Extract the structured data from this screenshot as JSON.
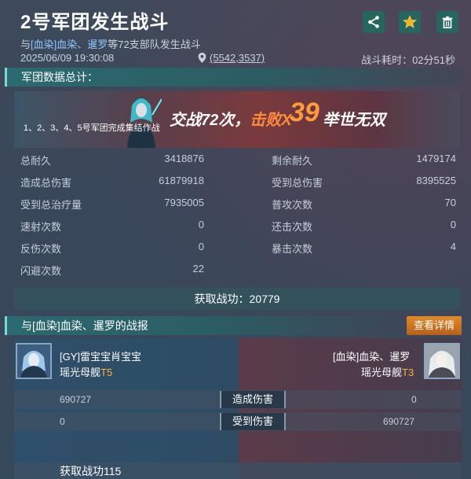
{
  "header": {
    "title": "2号军团发生战斗",
    "subtitle_prefix": "与",
    "subtitle_enemy": "[血染]血染、暹罗",
    "subtitle_suffix": "等72支部队发生战斗",
    "datetime": "2025/06/09 19:30:08",
    "coordinates": "(5542,3537)",
    "duration_label": "战斗耗时：",
    "duration_value": "02分51秒",
    "icons": [
      "share-icon",
      "star-icon",
      "trash-icon"
    ],
    "accent_color": "#27665f"
  },
  "summary": {
    "section_title": "军团数据总计：",
    "banner": {
      "battles": "交战72次，",
      "defeat_prefix": "击败X",
      "defeat_count": "39",
      "epithet": "举世无双",
      "note": "1、2、3、4、5号军团完成集结作战"
    },
    "stats": [
      {
        "label": "总耐久",
        "value": "3418876"
      },
      {
        "label": "剩余耐久",
        "value": "1479174"
      },
      {
        "label": "造成总伤害",
        "value": "61879918"
      },
      {
        "label": "受到总伤害",
        "value": "8395525"
      },
      {
        "label": "受到总治疗量",
        "value": "7935005"
      },
      {
        "label": "普攻次数",
        "value": "70"
      },
      {
        "label": "速射次数",
        "value": "0"
      },
      {
        "label": "还击次数",
        "value": "0"
      },
      {
        "label": "反伤次数",
        "value": "0"
      },
      {
        "label": "暴击次数",
        "value": "4"
      },
      {
        "label": "闪避次数",
        "value": "22"
      }
    ],
    "gain_label": "获取战功：",
    "gain_value": "20779"
  },
  "report": {
    "section_title": "与[血染]血染、暹罗的战报",
    "details_button": "查看详情",
    "left": {
      "name": "[GY]雷宝宝肖宝宝",
      "ship": "瑶光母舰",
      "tier": "T5"
    },
    "right": {
      "name": "[血染]血染、暹罗",
      "ship": "瑶光母舰",
      "tier": "T3"
    },
    "rows": [
      {
        "label": "造成伤害",
        "left": "690727",
        "right": "0"
      },
      {
        "label": "受到伤害",
        "left": "0",
        "right": "690727"
      }
    ],
    "bottom_gain": "获取战功115"
  }
}
